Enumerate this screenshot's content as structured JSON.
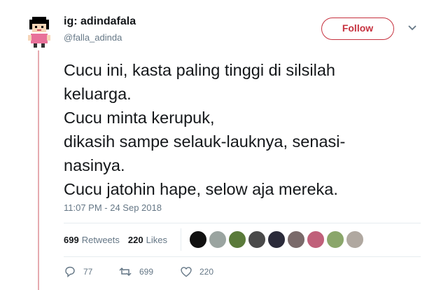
{
  "user": {
    "display_name": "ig: adindafala",
    "handle": "@falla_adinda"
  },
  "follow_label": "Follow",
  "tweet": {
    "lines": [
      "Cucu ini, kasta paling tinggi di silsilah",
      "keluarga.",
      "Cucu minta kerupuk,",
      "dikasih sampe selauk-lauknya, senasi-",
      "nasinya.",
      "Cucu jatohin hape, selow aja mereka."
    ],
    "timestamp": "11:07 PM - 24 Sep 2018"
  },
  "stats": {
    "retweets_count": "699",
    "retweets_label": "Retweets",
    "likes_count": "220",
    "likes_label": "Likes"
  },
  "likers_colors": [
    "#111111",
    "#9aa4a0",
    "#5a7a3a",
    "#4a4a4a",
    "#2b2b3a",
    "#7a6a6a",
    "#c0607a",
    "#8aa66a",
    "#b0a8a0"
  ],
  "actions": {
    "reply_count": "77",
    "retweet_count": "699",
    "like_count": "220"
  },
  "colors": {
    "accent": "#c6323f",
    "thread_line": "#e6aab0",
    "muted": "#657786"
  }
}
